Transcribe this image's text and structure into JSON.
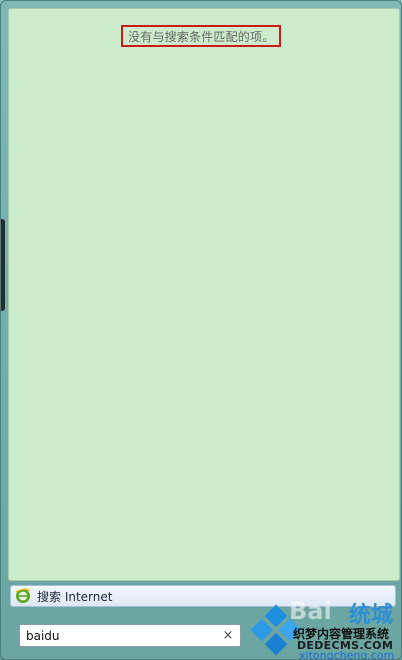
{
  "results": {
    "no_results_text": "没有与搜索条件匹配的项。"
  },
  "search_internet": {
    "label": "搜索 Internet",
    "icon": "ie-icon"
  },
  "search_box": {
    "value": "baidu",
    "clear_icon_glyph": "×"
  },
  "watermark": {
    "baidu_text": "Bai",
    "xt_text": "统城",
    "line1": "织梦内容管理系统",
    "line2": "DEDECMS.COM",
    "site": "xitongcheng.com"
  },
  "colors": {
    "results_background": "#cdeccc",
    "highlight_border": "#cc1a1a"
  }
}
